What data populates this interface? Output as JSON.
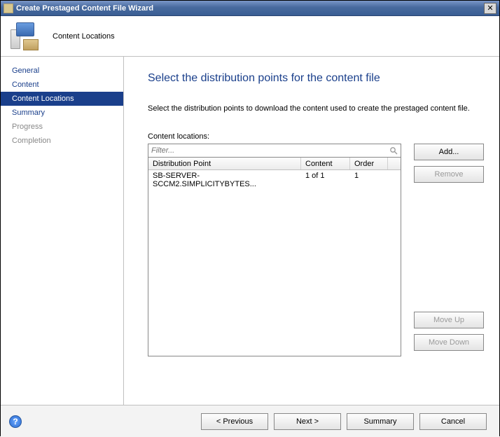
{
  "title": "Create Prestaged Content File Wizard",
  "header": {
    "label": "Content Locations"
  },
  "sidebar": {
    "items": [
      {
        "label": "General",
        "state": "link"
      },
      {
        "label": "Content",
        "state": "link"
      },
      {
        "label": "Content Locations",
        "state": "selected"
      },
      {
        "label": "Summary",
        "state": "link"
      },
      {
        "label": "Progress",
        "state": "disabled"
      },
      {
        "label": "Completion",
        "state": "disabled"
      }
    ]
  },
  "main": {
    "title": "Select the distribution points for the content file",
    "instruction": "Select the distribution points to download the content used to create the prestaged content file.",
    "list_label": "Content locations:",
    "filter_placeholder": "Filter...",
    "columns": {
      "dp": "Distribution Point",
      "content": "Content",
      "order": "Order"
    },
    "rows": [
      {
        "dp": "SB-SERVER-SCCM2.SIMPLICITYBYTES...",
        "content": "1 of 1",
        "order": "1"
      }
    ],
    "buttons": {
      "add": "Add...",
      "remove": "Remove",
      "move_up": "Move Up",
      "move_down": "Move Down"
    }
  },
  "footer": {
    "previous": "< Previous",
    "next": "Next >",
    "summary": "Summary",
    "cancel": "Cancel"
  }
}
